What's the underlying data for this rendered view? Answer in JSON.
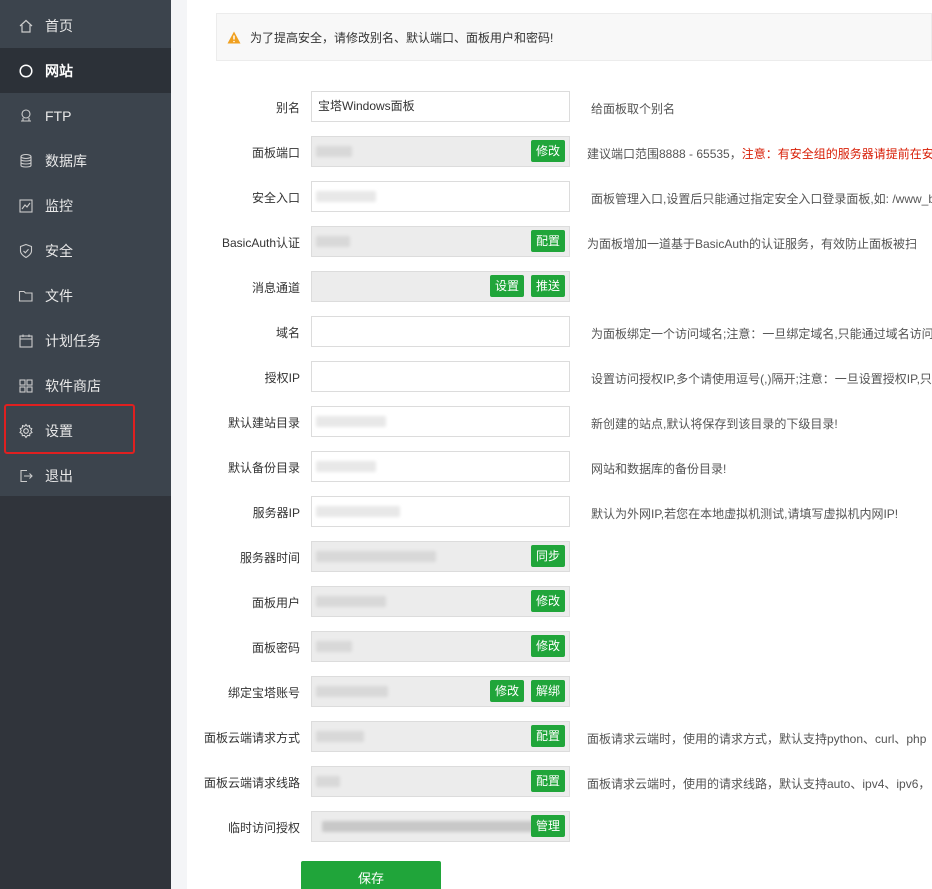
{
  "sidebar": {
    "items": [
      {
        "label": "首页",
        "icon": "home-icon"
      },
      {
        "label": "网站",
        "icon": "globe-icon"
      },
      {
        "label": "FTP",
        "icon": "ftp-icon"
      },
      {
        "label": "数据库",
        "icon": "database-icon"
      },
      {
        "label": "监控",
        "icon": "monitor-icon"
      },
      {
        "label": "安全",
        "icon": "shield-icon"
      },
      {
        "label": "文件",
        "icon": "folder-icon"
      },
      {
        "label": "计划任务",
        "icon": "calendar-icon"
      },
      {
        "label": "软件商店",
        "icon": "apps-icon"
      },
      {
        "label": "设置",
        "icon": "gear-icon"
      },
      {
        "label": "退出",
        "icon": "logout-icon"
      }
    ],
    "active_label": "网站",
    "highlighted_label": "设置"
  },
  "alert": {
    "text": "为了提高安全，请修改别名、默认端口、面板用户和密码!"
  },
  "form": {
    "alias": {
      "label": "别名",
      "value": "宝塔Windows面板",
      "hint": "给面板取个别名"
    },
    "port": {
      "label": "面板端口",
      "button": "修改",
      "hint": "建议端口范围8888 - 65535，",
      "hint_red": "注意：有安全组的服务器请提前在安"
    },
    "entrance": {
      "label": "安全入口",
      "hint": "面板管理入口,设置后只能通过指定安全入口登录面板,如: /www_b"
    },
    "basicauth": {
      "label": "BasicAuth认证",
      "button": "配置",
      "hint": "为面板增加一道基于BasicAuth的认证服务，有效防止面板被扫"
    },
    "message": {
      "label": "消息通道",
      "button1": "设置",
      "button2": "推送"
    },
    "domain": {
      "label": "域名",
      "value": "",
      "hint": "为面板绑定一个访问域名;注意：一旦绑定域名,只能通过域名访问"
    },
    "auth_ip": {
      "label": "授权IP",
      "value": "",
      "hint": "设置访问授权IP,多个请使用逗号(,)隔开;注意：一旦设置授权IP,只"
    },
    "site_dir": {
      "label": "默认建站目录",
      "hint": "新创建的站点,默认将保存到该目录的下级目录!"
    },
    "backup_dir": {
      "label": "默认备份目录",
      "hint": "网站和数据库的备份目录!"
    },
    "server_ip": {
      "label": "服务器IP",
      "hint": "默认为外网IP,若您在本地虚拟机测试,请填写虚拟机内网IP!"
    },
    "server_time": {
      "label": "服务器时间",
      "button": "同步"
    },
    "panel_user": {
      "label": "面板用户",
      "button": "修改"
    },
    "panel_pwd": {
      "label": "面板密码",
      "button": "修改"
    },
    "bt_account": {
      "label": "绑定宝塔账号",
      "button1": "修改",
      "button2": "解绑"
    },
    "cloud_method": {
      "label": "面板云端请求方式",
      "button": "配置",
      "hint": "面板请求云端时，使用的请求方式，默认支持python、curl、php"
    },
    "cloud_line": {
      "label": "面板云端请求线路",
      "button": "配置",
      "hint": "面板请求云端时，使用的请求线路，默认支持auto、ipv4、ipv6，"
    },
    "temp_auth": {
      "label": "临时访问授权",
      "button": "管理"
    },
    "save": "保存"
  },
  "colors": {
    "sidebar": "#3c444d",
    "accent": "#20a53a",
    "highlight": "#e02020",
    "warn": "#f0a020"
  }
}
